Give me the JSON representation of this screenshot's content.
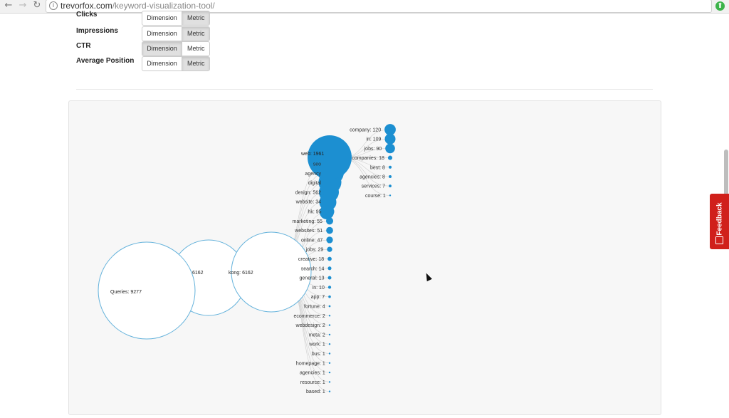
{
  "browser": {
    "url_host": "trevorfox.com",
    "url_path": "/keyword-visualization-tool/"
  },
  "metrics": [
    {
      "label": "Clicks",
      "dimension": "Dimension",
      "metric": "Metric",
      "selected": "metric"
    },
    {
      "label": "Impressions",
      "dimension": "Dimension",
      "metric": "Metric",
      "selected": "metric"
    },
    {
      "label": "CTR",
      "dimension": "Dimension",
      "metric": "Metric",
      "selected": "dimension"
    },
    {
      "label": "Average Position",
      "dimension": "Dimension",
      "metric": "Metric",
      "selected": "metric"
    }
  ],
  "viz": {
    "root": "Queries: 9277",
    "middle_label": "6162",
    "kong": "kong: 6162",
    "big_node": "web: 1961",
    "left_leaves": [
      "seo",
      "agency",
      "digital",
      "design: 562",
      "website: 34"
    ],
    "right_leaves": [
      "company: 120",
      "in: 109",
      "jobs: 90",
      "companies: 18",
      "best: 8",
      "agencies: 8",
      "services: 7",
      "course: 1"
    ],
    "hk_leaves": [
      "hk: 95",
      "marketing: 55",
      "websites: 51",
      "online: 47",
      "jobs: 29",
      "creative: 18",
      "search: 14",
      "general: 13",
      "in: 10",
      "app: 7",
      "fortune: 4",
      "ecommerce: 2",
      "webdesign: 2",
      "meta: 2",
      "work: 1",
      "bus: 1",
      "homepage: 1",
      "agencies: 1",
      "resource: 1",
      "based: 1"
    ]
  },
  "feedback": {
    "label": "Feedback"
  },
  "colors": {
    "node_fill": "#1c8fd1",
    "circle_stroke": "#64b2db",
    "feedback": "#d0201b"
  }
}
